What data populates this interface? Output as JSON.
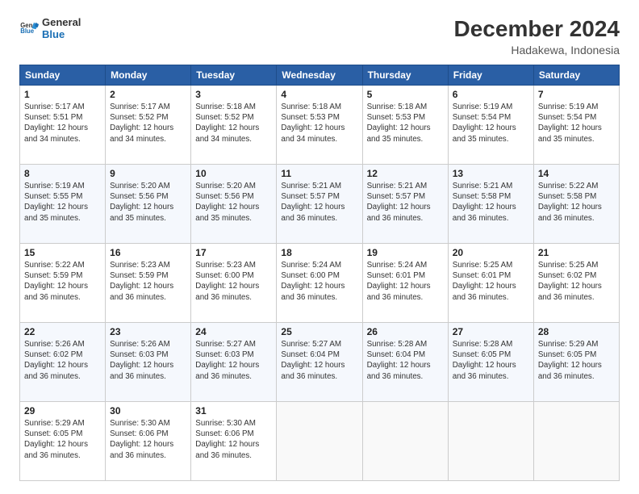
{
  "logo": {
    "line1": "General",
    "line2": "Blue"
  },
  "title": "December 2024",
  "subtitle": "Hadakewa, Indonesia",
  "days_header": [
    "Sunday",
    "Monday",
    "Tuesday",
    "Wednesday",
    "Thursday",
    "Friday",
    "Saturday"
  ],
  "weeks": [
    [
      {
        "day": "1",
        "sunrise": "5:17 AM",
        "sunset": "5:51 PM",
        "daylight": "12 hours and 34 minutes."
      },
      {
        "day": "2",
        "sunrise": "5:17 AM",
        "sunset": "5:52 PM",
        "daylight": "12 hours and 34 minutes."
      },
      {
        "day": "3",
        "sunrise": "5:18 AM",
        "sunset": "5:52 PM",
        "daylight": "12 hours and 34 minutes."
      },
      {
        "day": "4",
        "sunrise": "5:18 AM",
        "sunset": "5:53 PM",
        "daylight": "12 hours and 34 minutes."
      },
      {
        "day": "5",
        "sunrise": "5:18 AM",
        "sunset": "5:53 PM",
        "daylight": "12 hours and 35 minutes."
      },
      {
        "day": "6",
        "sunrise": "5:19 AM",
        "sunset": "5:54 PM",
        "daylight": "12 hours and 35 minutes."
      },
      {
        "day": "7",
        "sunrise": "5:19 AM",
        "sunset": "5:54 PM",
        "daylight": "12 hours and 35 minutes."
      }
    ],
    [
      {
        "day": "8",
        "sunrise": "5:19 AM",
        "sunset": "5:55 PM",
        "daylight": "12 hours and 35 minutes."
      },
      {
        "day": "9",
        "sunrise": "5:20 AM",
        "sunset": "5:56 PM",
        "daylight": "12 hours and 35 minutes."
      },
      {
        "day": "10",
        "sunrise": "5:20 AM",
        "sunset": "5:56 PM",
        "daylight": "12 hours and 35 minutes."
      },
      {
        "day": "11",
        "sunrise": "5:21 AM",
        "sunset": "5:57 PM",
        "daylight": "12 hours and 36 minutes."
      },
      {
        "day": "12",
        "sunrise": "5:21 AM",
        "sunset": "5:57 PM",
        "daylight": "12 hours and 36 minutes."
      },
      {
        "day": "13",
        "sunrise": "5:21 AM",
        "sunset": "5:58 PM",
        "daylight": "12 hours and 36 minutes."
      },
      {
        "day": "14",
        "sunrise": "5:22 AM",
        "sunset": "5:58 PM",
        "daylight": "12 hours and 36 minutes."
      }
    ],
    [
      {
        "day": "15",
        "sunrise": "5:22 AM",
        "sunset": "5:59 PM",
        "daylight": "12 hours and 36 minutes."
      },
      {
        "day": "16",
        "sunrise": "5:23 AM",
        "sunset": "5:59 PM",
        "daylight": "12 hours and 36 minutes."
      },
      {
        "day": "17",
        "sunrise": "5:23 AM",
        "sunset": "6:00 PM",
        "daylight": "12 hours and 36 minutes."
      },
      {
        "day": "18",
        "sunrise": "5:24 AM",
        "sunset": "6:00 PM",
        "daylight": "12 hours and 36 minutes."
      },
      {
        "day": "19",
        "sunrise": "5:24 AM",
        "sunset": "6:01 PM",
        "daylight": "12 hours and 36 minutes."
      },
      {
        "day": "20",
        "sunrise": "5:25 AM",
        "sunset": "6:01 PM",
        "daylight": "12 hours and 36 minutes."
      },
      {
        "day": "21",
        "sunrise": "5:25 AM",
        "sunset": "6:02 PM",
        "daylight": "12 hours and 36 minutes."
      }
    ],
    [
      {
        "day": "22",
        "sunrise": "5:26 AM",
        "sunset": "6:02 PM",
        "daylight": "12 hours and 36 minutes."
      },
      {
        "day": "23",
        "sunrise": "5:26 AM",
        "sunset": "6:03 PM",
        "daylight": "12 hours and 36 minutes."
      },
      {
        "day": "24",
        "sunrise": "5:27 AM",
        "sunset": "6:03 PM",
        "daylight": "12 hours and 36 minutes."
      },
      {
        "day": "25",
        "sunrise": "5:27 AM",
        "sunset": "6:04 PM",
        "daylight": "12 hours and 36 minutes."
      },
      {
        "day": "26",
        "sunrise": "5:28 AM",
        "sunset": "6:04 PM",
        "daylight": "12 hours and 36 minutes."
      },
      {
        "day": "27",
        "sunrise": "5:28 AM",
        "sunset": "6:05 PM",
        "daylight": "12 hours and 36 minutes."
      },
      {
        "day": "28",
        "sunrise": "5:29 AM",
        "sunset": "6:05 PM",
        "daylight": "12 hours and 36 minutes."
      }
    ],
    [
      {
        "day": "29",
        "sunrise": "5:29 AM",
        "sunset": "6:05 PM",
        "daylight": "12 hours and 36 minutes."
      },
      {
        "day": "30",
        "sunrise": "5:30 AM",
        "sunset": "6:06 PM",
        "daylight": "12 hours and 36 minutes."
      },
      {
        "day": "31",
        "sunrise": "5:30 AM",
        "sunset": "6:06 PM",
        "daylight": "12 hours and 36 minutes."
      },
      null,
      null,
      null,
      null
    ]
  ],
  "labels": {
    "sunrise": "Sunrise:",
    "sunset": "Sunset:",
    "daylight": "Daylight:"
  }
}
